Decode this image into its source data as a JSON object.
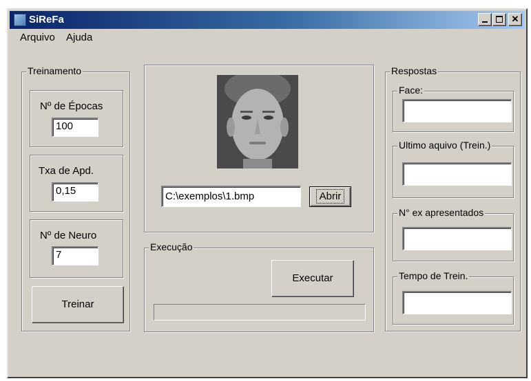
{
  "window": {
    "title": "SiReFa"
  },
  "menu": {
    "items": [
      "Arquivo",
      "Ajuda"
    ]
  },
  "treinamento": {
    "legend": "Treinamento",
    "epocas": {
      "label": "Nº de Épocas",
      "value": "100"
    },
    "taxa": {
      "label": "Txa de Apd.",
      "value": "0,15"
    },
    "neuro": {
      "label": "Nº de Neuro",
      "value": "7"
    },
    "treinar_button": "Treinar"
  },
  "imagem": {
    "path_value": "C:\\exemplos\\1.bmp",
    "abrir_button": "Abrir"
  },
  "execucao": {
    "legend": "Execução",
    "executar_button": "Executar",
    "progress": 0
  },
  "respostas": {
    "legend": "Respostas",
    "face": {
      "label": "Face:",
      "value": ""
    },
    "ultimo_arquivo": {
      "label": "Ultimo aquivo (Trein.)",
      "value": ""
    },
    "exemplos": {
      "label": "N° ex apresentados",
      "value": ""
    },
    "tempo": {
      "label": "Tempo de Trein.",
      "value": ""
    }
  }
}
